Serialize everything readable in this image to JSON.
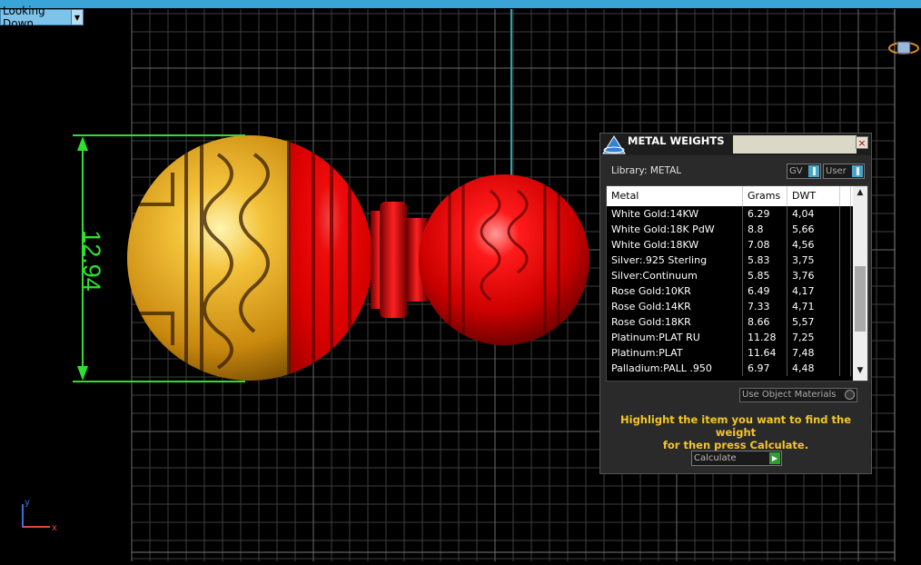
{
  "viewport": {
    "view_label": "Looking Down",
    "dimension_value": "12.94",
    "axis_x_label": "x",
    "axis_y_label": "y"
  },
  "metal_weights_panel": {
    "title": "METAL WEIGHTS",
    "close_label": "×",
    "library_label": "Library:  METAL",
    "gv_label": "GV",
    "user_label": "User",
    "columns": [
      "Metal",
      "Grams",
      "DWT"
    ],
    "rows": [
      {
        "metal": "White Gold:14KW",
        "grams": "6.29",
        "dwt": "4,04"
      },
      {
        "metal": "White Gold:18K PdW",
        "grams": "8.8",
        "dwt": "5,66"
      },
      {
        "metal": "White Gold:18KW",
        "grams": "7.08",
        "dwt": "4,56"
      },
      {
        "metal": "Silver:.925 Sterling",
        "grams": "5.83",
        "dwt": "3,75"
      },
      {
        "metal": "Silver:Continuum",
        "grams": "5.85",
        "dwt": "3,76"
      },
      {
        "metal": "Rose Gold:10KR",
        "grams": "6.49",
        "dwt": "4,17"
      },
      {
        "metal": "Rose Gold:14KR",
        "grams": "7.33",
        "dwt": "4,71"
      },
      {
        "metal": "Rose Gold:18KR",
        "grams": "8.66",
        "dwt": "5,57"
      },
      {
        "metal": "Platinum:PLAT RU",
        "grams": "11.28",
        "dwt": "7,25"
      },
      {
        "metal": "Platinum:PLAT",
        "grams": "11.64",
        "dwt": "7,48"
      },
      {
        "metal": "Palladium:PALL .950",
        "grams": "6.97",
        "dwt": "4,48"
      }
    ],
    "use_object_materials_label": "Use Object Materials",
    "hint_line1": "Highlight the item you want to find the weight",
    "hint_line2": "for then press Calculate.",
    "calculate_label": "Calculate"
  },
  "colors": {
    "gold": "#e0a520",
    "red": "#e00000",
    "dimension_green": "#2ee02e",
    "hint_yellow": "#f5c52a",
    "grid_line": "#5a5a5a",
    "panel_bg": "#2a2a2a"
  }
}
